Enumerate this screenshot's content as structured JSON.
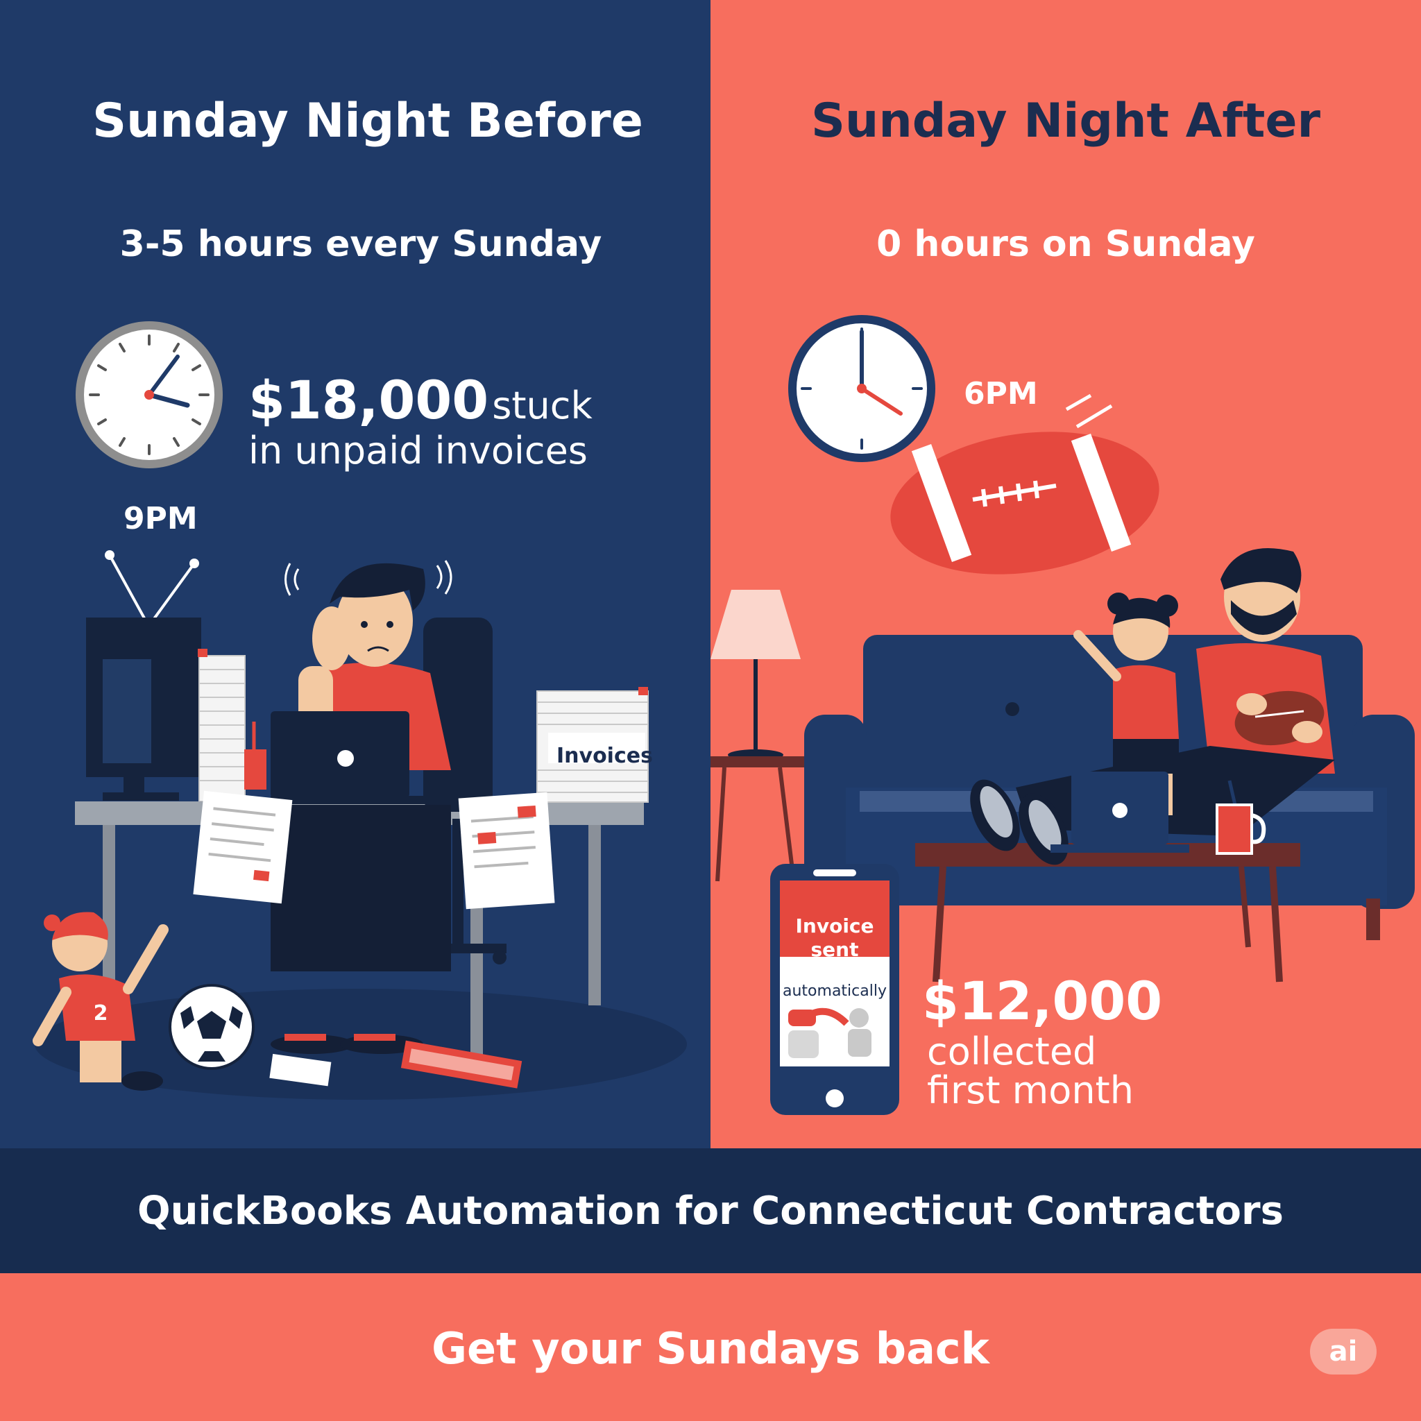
{
  "before": {
    "title": "Sunday Night Before",
    "hours": "3-5 hours every Sunday",
    "time": "9PM",
    "amount": "$18,000",
    "amount_suffix": "stuck",
    "amount_line2": "in unpaid invoices",
    "invoices_label": "Invoices",
    "jersey_number": "2"
  },
  "after": {
    "title": "Sunday Night After",
    "hours": "0 hours on Sunday",
    "time": "6PM",
    "phone": {
      "line1": "Invoice",
      "line2": "sent",
      "line3": "automatically"
    },
    "amount": "$12,000",
    "amount_line2": "collected",
    "amount_line3": "first month"
  },
  "banner": {
    "text": "QuickBooks Automation for Connecticut Contractors"
  },
  "cta": {
    "text": "Get your Sundays back",
    "badge": "ai"
  },
  "colors": {
    "navy": "#1f3a68",
    "dark_navy": "#172c4f",
    "coral": "#f76e5e",
    "red": "#e5483e",
    "white": "#ffffff"
  }
}
